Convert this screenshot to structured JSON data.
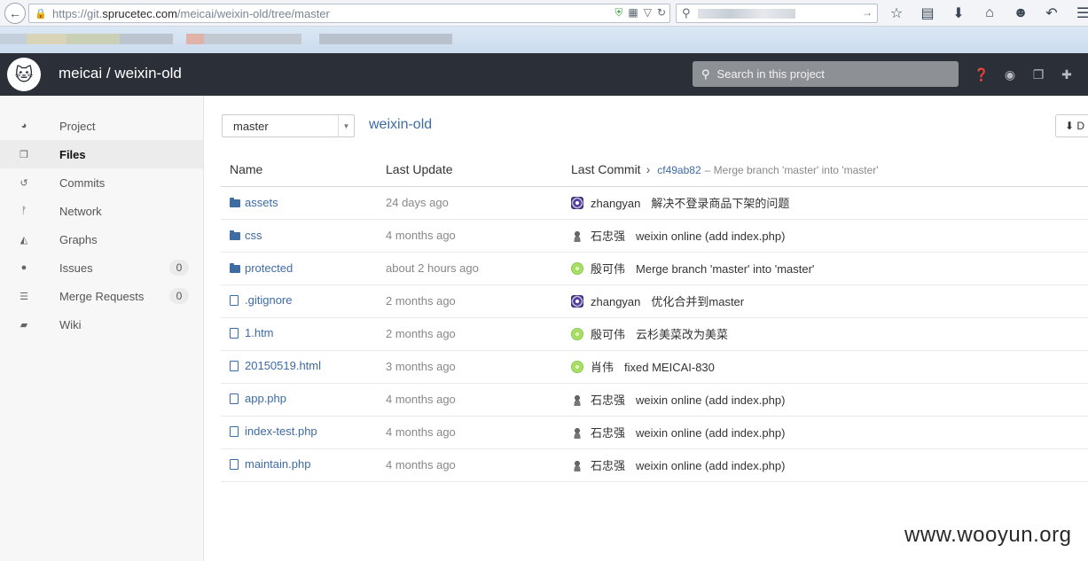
{
  "browser": {
    "url_prefix": "https://git.",
    "url_domain": "sprucetec.com",
    "url_path": "/meicai/weixin-old/tree/master"
  },
  "header": {
    "project_title": "meicai / weixin-old",
    "search_placeholder": "Search in this project"
  },
  "sidebar": {
    "items": [
      {
        "label": "Project",
        "icon": "dashboard-icon",
        "glyph": "◕"
      },
      {
        "label": "Files",
        "icon": "files-icon",
        "glyph": "❐",
        "active": true
      },
      {
        "label": "Commits",
        "icon": "history-icon",
        "glyph": "↺"
      },
      {
        "label": "Network",
        "icon": "branch-icon",
        "glyph": "ᚠ"
      },
      {
        "label": "Graphs",
        "icon": "area-chart-icon",
        "glyph": "◭"
      },
      {
        "label": "Issues",
        "icon": "exclamation-icon",
        "glyph": "●",
        "count": "0"
      },
      {
        "label": "Merge Requests",
        "icon": "list-icon",
        "glyph": "☰",
        "count": "0"
      },
      {
        "label": "Wiki",
        "icon": "book-icon",
        "glyph": "▰"
      }
    ]
  },
  "main": {
    "branch": "master",
    "repo_name": "weixin-old",
    "download_label": "D",
    "columns": {
      "name": "Name",
      "last_update": "Last Update",
      "last_commit": "Last Commit"
    },
    "last_commit_sha": "cf49ab82",
    "last_commit_message": "– Merge branch 'master' into 'master'",
    "files": [
      {
        "name": "assets",
        "type": "folder",
        "updated": "24 days ago",
        "author": "zhangyan",
        "avatar": "purple",
        "message": "解决不登录商品下架的问题"
      },
      {
        "name": "css",
        "type": "folder",
        "updated": "4 months ago",
        "author": "石忠强",
        "avatar": "person",
        "message": "weixin online (add index.php)"
      },
      {
        "name": "protected",
        "type": "folder",
        "updated": "about 2 hours ago",
        "author": "殷可伟",
        "avatar": "green",
        "message": "Merge branch 'master' into 'master'"
      },
      {
        "name": ".gitignore",
        "type": "file",
        "updated": "2 months ago",
        "author": "zhangyan",
        "avatar": "purple",
        "message": "优化合并到master"
      },
      {
        "name": "1.htm",
        "type": "file",
        "updated": "2 months ago",
        "author": "殷可伟",
        "avatar": "green",
        "message": "云杉美菜改为美菜"
      },
      {
        "name": "20150519.html",
        "type": "file",
        "updated": "3 months ago",
        "author": "肖伟",
        "avatar": "green",
        "message": "fixed MEICAI-830"
      },
      {
        "name": "app.php",
        "type": "file",
        "updated": "4 months ago",
        "author": "石忠强",
        "avatar": "person",
        "message": "weixin online (add index.php)"
      },
      {
        "name": "index-test.php",
        "type": "file",
        "updated": "4 months ago",
        "author": "石忠强",
        "avatar": "person",
        "message": "weixin online (add index.php)"
      },
      {
        "name": "maintain.php",
        "type": "file",
        "updated": "4 months ago",
        "author": "石忠强",
        "avatar": "person",
        "message": "weixin online (add index.php)"
      }
    ]
  },
  "watermark": "www.wooyun.org"
}
